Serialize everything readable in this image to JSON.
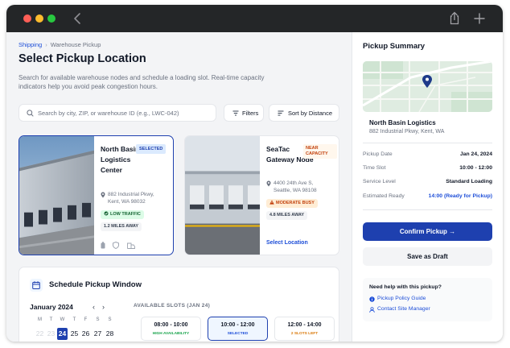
{
  "breadcrumb": {
    "parent": "Shipping",
    "separator": "›",
    "current": "Warehouse Pickup"
  },
  "page": {
    "title": "Select Pickup Location",
    "description": "Search for available warehouse nodes and schedule a loading slot. Real-time capacity indicators help you avoid peak congestion hours."
  },
  "search": {
    "placeholder": "Search by city, ZIP, or warehouse ID (e.g., LWC-042)",
    "value": ""
  },
  "toolbar": {
    "filters_label": "Filters",
    "sort_label": "Sort by Distance"
  },
  "locations": [
    {
      "name": "North Basin Logistics Center",
      "badge": "SELECTED",
      "address": "882 Industrial Pkwy, Kent, WA 98032",
      "traffic": "LOW TRAFFIC",
      "distance": "1.2 MILES AWAY",
      "selected": true
    },
    {
      "name": "SeaTac Gateway Node",
      "badge": "NEAR CAPACITY",
      "address": "4400 24th Ave S, Seattle, WA 98108",
      "traffic": "MODERATE BUSY",
      "distance": "4.8 MILES AWAY",
      "action": "Select Location",
      "selected": false
    }
  ],
  "schedule": {
    "title": "Schedule Pickup Window",
    "month": "January 2024",
    "nav_prev": "‹",
    "nav_next": "›",
    "weekdays": [
      "M",
      "T",
      "W",
      "T",
      "F",
      "S",
      "S"
    ],
    "days": [
      "22",
      "23",
      "24",
      "25",
      "26",
      "27",
      "28"
    ],
    "selected_day": "24",
    "slots_label": "AVAILABLE SLOTS (JAN 24)",
    "slots": [
      {
        "time": "08:00 - 10:00",
        "status": "HIGH AVAILABILITY"
      },
      {
        "time": "10:00 - 12:00",
        "status": "SELECTED"
      },
      {
        "time": "12:00 - 14:00",
        "status": "2 SLOTS LEFT"
      }
    ]
  },
  "summary": {
    "title": "Pickup Summary",
    "location_name": "North Basin Logistics",
    "location_address": "882 Industrial Pkwy, Kent, WA",
    "rows": [
      {
        "label": "Pickup Date",
        "value": "Jan 24, 2024"
      },
      {
        "label": "Time Slot",
        "value": "10:00 - 12:00"
      },
      {
        "label": "Service Level",
        "value": "Standard Loading"
      },
      {
        "label": "Estimated Ready",
        "value": "14:00 (Ready for Pickup)"
      }
    ],
    "confirm_label": "Confirm Pickup →",
    "draft_label": "Save as Draft",
    "help_title": "Need help with this pickup?",
    "help_links": [
      "Pickup Policy Guide",
      "Contact Site Manager"
    ]
  },
  "colors": {
    "primary": "#1e40af",
    "link": "#1d4ed8",
    "success": "#166534",
    "warning": "#c2410c",
    "titlebar": "#242628"
  },
  "icons": [
    "back-chevron-icon",
    "share-icon",
    "plus-icon",
    "search-icon",
    "filter-icon",
    "sort-icon",
    "map-pin-icon",
    "traffic-icon",
    "warning-icon",
    "battery-icon",
    "shield-icon",
    "loading-dock-icon",
    "calendar-icon",
    "document-icon",
    "user-icon"
  ]
}
